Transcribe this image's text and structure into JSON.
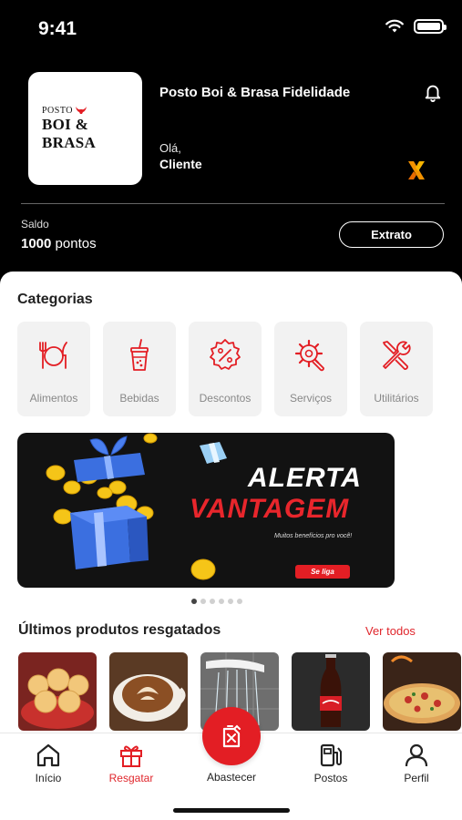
{
  "status_bar": {
    "time": "9:41"
  },
  "header": {
    "logo": {
      "top_text": "POSTO",
      "main_text": "BOI & BRASA"
    },
    "program_title": "Posto Boi & Brasa Fidelidade",
    "greeting": "Olá,",
    "client_name": "Cliente",
    "balance_label": "Saldo",
    "balance_value": "1000",
    "balance_unit": "pontos",
    "statement_button": "Extrato"
  },
  "categories": {
    "title": "Categorias",
    "items": [
      {
        "label": "Alimentos",
        "icon": "utensils-icon"
      },
      {
        "label": "Bebidas",
        "icon": "drink-cup-icon"
      },
      {
        "label": "Descontos",
        "icon": "discount-badge-icon"
      },
      {
        "label": "Serviços",
        "icon": "gear-wrench-icon"
      },
      {
        "label": "Utilitários",
        "icon": "tools-icon"
      }
    ]
  },
  "banner": {
    "title_line1": "ALERTA",
    "title_line2": "VANTAGEM",
    "subtitle": "Muitos benefícios pro você!",
    "cta": "Se liga",
    "active_slide": 1,
    "slide_count": 6
  },
  "products": {
    "title": "Últimos produtos resgatados",
    "see_all": "Ver todos",
    "items": [
      {
        "image": "cheese-bread"
      },
      {
        "image": "cappuccino"
      },
      {
        "image": "shower-head"
      },
      {
        "image": "cola-bottle"
      },
      {
        "image": "pizza"
      }
    ]
  },
  "tabbar": {
    "items": [
      {
        "label": "Início",
        "icon": "home-icon"
      },
      {
        "label": "Resgatar",
        "icon": "gift-icon",
        "active": true
      },
      {
        "label": "Abastecer",
        "icon": "fuel-can-icon"
      },
      {
        "label": "Postos",
        "icon": "gas-station-icon"
      },
      {
        "label": "Perfil",
        "icon": "user-icon"
      }
    ]
  },
  "colors": {
    "accent": "#e31e24",
    "header_bg": "#000000",
    "card_bg": "#f2f2f2"
  }
}
